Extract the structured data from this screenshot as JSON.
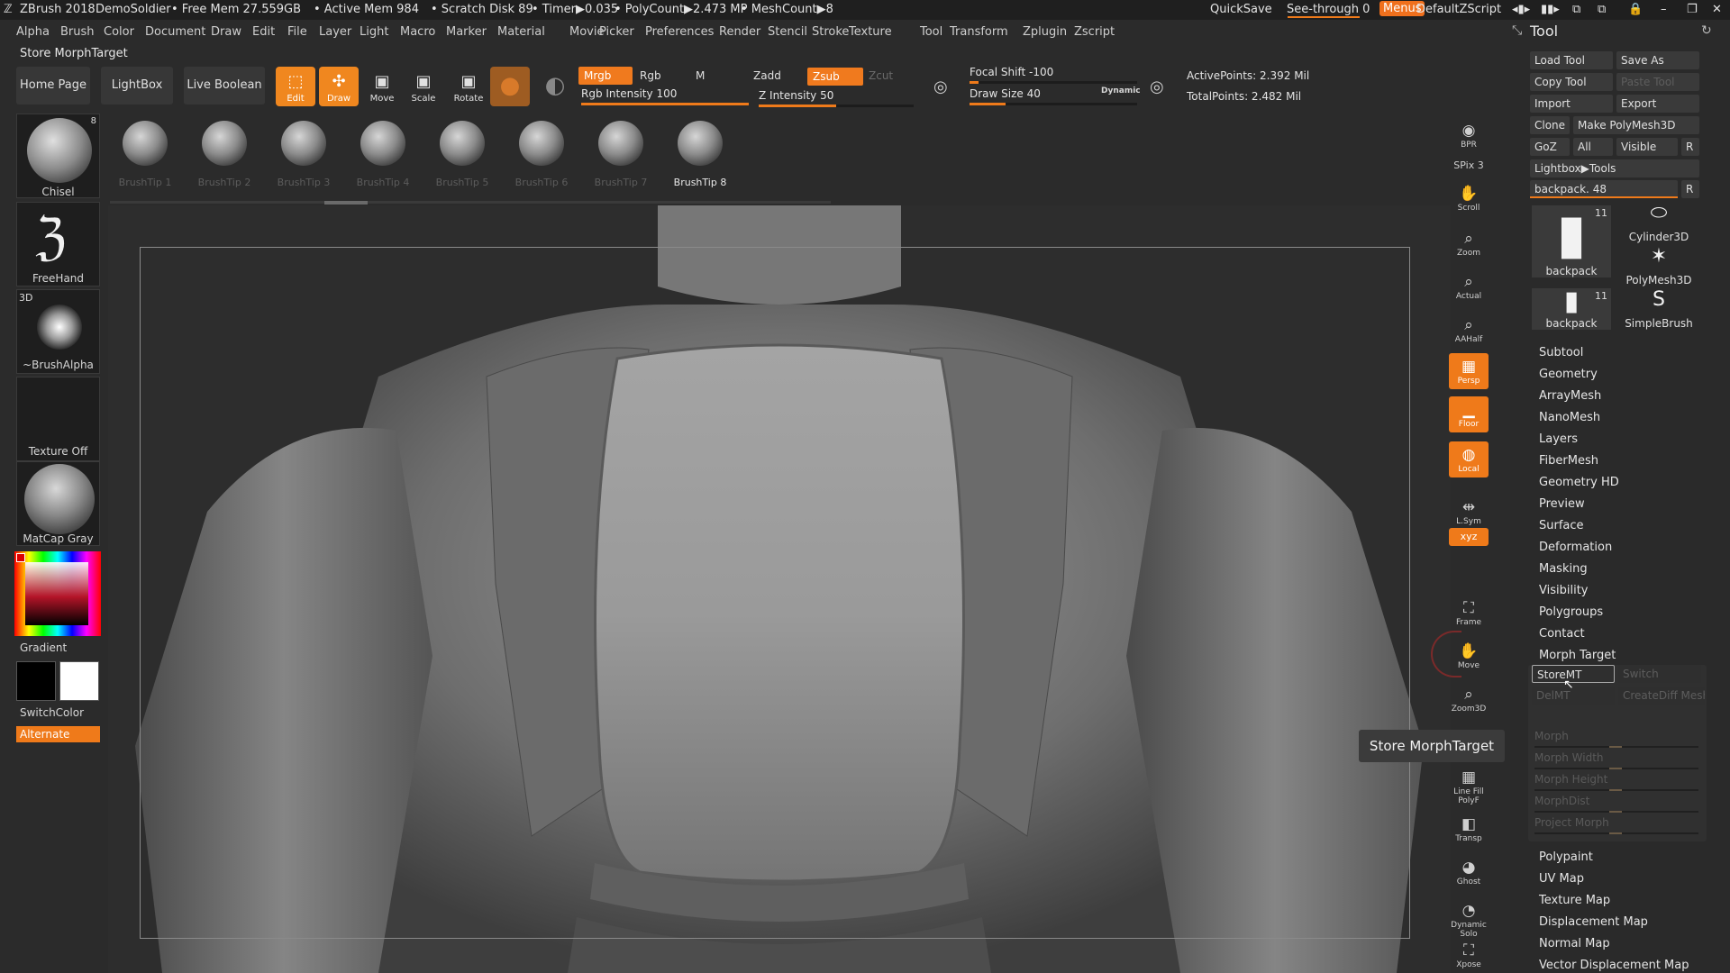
{
  "titlebar": {
    "app": "ZBrush 2018",
    "doc": "DemoSoldier",
    "free_mem": "• Free Mem 27.559GB",
    "active_mem": "• Active Mem 984",
    "scratch": "• Scratch Disk 89",
    "timer": "• Timer▶0.035",
    "polycount": "• PolyCount▶2.473 MP",
    "meshcount": "• MeshCount▶8",
    "quicksave": "QuickSave",
    "see_through": "See-through",
    "see_through_value": "0",
    "menus": "Menus",
    "script": "DefaultZScript"
  },
  "menubar": [
    "Alpha",
    "Brush",
    "Color",
    "Document",
    "Draw",
    "Edit",
    "File",
    "Layer",
    "Light",
    "Macro",
    "Marker",
    "Material",
    "Movie",
    "Picker",
    "Preferences",
    "Render",
    "Stencil",
    "Stroke",
    "Texture",
    "Tool",
    "Transform",
    "Zplugin",
    "Zscript"
  ],
  "status_text": "Store MorphTarget",
  "shelf": {
    "home": "Home Page",
    "lightbox": "LightBox",
    "live_boolean": "Live Boolean",
    "edit": "Edit",
    "draw": "Draw",
    "move": "Move",
    "scale": "Scale",
    "rotate": "Rotate",
    "mrgb": "Mrgb",
    "rgb": "Rgb",
    "m": "M",
    "zadd": "Zadd",
    "zsub": "Zsub",
    "zcut": "Zcut",
    "rgb_intensity_label": "Rgb Intensity",
    "rgb_intensity": "100",
    "rgb_intensity_level": 1.0,
    "z_intensity_label": "Z Intensity",
    "z_intensity": "50",
    "z_intensity_level": 0.5,
    "focal_shift_label": "Focal Shift",
    "focal_shift": "-100",
    "draw_size_label": "Draw Size",
    "draw_size": "40",
    "dynamic": "Dynamic",
    "active_points": "ActivePoints: 2.392 Mil",
    "total_points": "TotalPoints: 2.482 Mil"
  },
  "brushtips": [
    {
      "label": "BrushTip 1",
      "active": false
    },
    {
      "label": "BrushTip 2",
      "active": false
    },
    {
      "label": "BrushTip 3",
      "active": false
    },
    {
      "label": "BrushTip 4",
      "active": false
    },
    {
      "label": "BrushTip 5",
      "active": false
    },
    {
      "label": "BrushTip 6",
      "active": false
    },
    {
      "label": "BrushTip 7",
      "active": false
    },
    {
      "label": "BrushTip 8",
      "active": true
    }
  ],
  "left": {
    "brush": "Chisel",
    "brush_count": "8",
    "stroke": "FreeHand",
    "alpha_tag": "3D",
    "alpha": "~BrushAlpha",
    "texture": "Texture Off",
    "material": "MatCap Gray",
    "gradient": "Gradient",
    "switchcolor": "SwitchColor",
    "alternate": "Alternate"
  },
  "right_shelf": [
    {
      "label": "BPR",
      "glyph": "◉",
      "on": false
    },
    {
      "label": "SPix 3",
      "glyph": "",
      "on": false
    },
    {
      "label": "Scroll",
      "glyph": "✋",
      "on": false
    },
    {
      "label": "Zoom",
      "glyph": "⌕",
      "on": false
    },
    {
      "label": "Actual",
      "glyph": "⌕",
      "on": false
    },
    {
      "label": "AAHalf",
      "glyph": "⌕",
      "on": false
    },
    {
      "label": "Persp",
      "glyph": "▦",
      "on": true
    },
    {
      "label": "Floor",
      "glyph": "▁",
      "on": true
    },
    {
      "label": "Local",
      "glyph": "◍",
      "on": true
    },
    {
      "label": "L.Sym",
      "glyph": "⇹",
      "on": false
    },
    {
      "label": "xyz",
      "glyph": "",
      "on": true
    },
    {
      "label": "Frame",
      "glyph": "⛶",
      "on": false
    },
    {
      "label": "Move",
      "glyph": "✋",
      "on": false
    },
    {
      "label": "Zoom3D",
      "glyph": "⌕",
      "on": false
    },
    {
      "label": "Line Fill PolyF",
      "glyph": "▦",
      "on": false
    },
    {
      "label": "Transp",
      "glyph": "◧",
      "on": false
    },
    {
      "label": "Ghost",
      "glyph": "◕",
      "on": false
    },
    {
      "label": "Dynamic Solo",
      "glyph": "◔",
      "on": false
    },
    {
      "label": "Xpose",
      "glyph": "⛶",
      "on": false
    }
  ],
  "toolpanel": {
    "title": "Tool",
    "load_tool": "Load Tool",
    "save_as": "Save As",
    "copy_tool": "Copy Tool",
    "paste_tool": "Paste Tool",
    "import": "Import",
    "export": "Export",
    "clone": "Clone",
    "make_polymesh": "Make PolyMesh3D",
    "goz": "GoZ",
    "all": "All",
    "visible": "Visible",
    "r": "R",
    "lightbox_tools": "Lightbox▶Tools",
    "tool_name": "backpack.",
    "tool_value": "48",
    "thumbs": [
      {
        "label": "backpack",
        "count": "11"
      },
      {
        "label": "Cylinder3D",
        "count": ""
      },
      {
        "label": "PolyMesh3D",
        "count": ""
      },
      {
        "label": "backpack",
        "count": "11"
      },
      {
        "label": "SimpleBrush",
        "count": ""
      }
    ],
    "sections": [
      "Subtool",
      "Geometry",
      "ArrayMesh",
      "NanoMesh",
      "Layers",
      "FiberMesh",
      "Geometry HD",
      "Preview",
      "Surface",
      "Deformation",
      "Masking",
      "Visibility",
      "Polygroups",
      "Contact",
      "Morph Target"
    ],
    "morph": {
      "storemt": "StoreMT",
      "switch": "Switch",
      "delmt": "DelMT",
      "creatediff": "CreateDiff Mesh",
      "sliders": [
        "Morph",
        "Morph Width",
        "Morph Height",
        "MorphDist",
        "Project Morph"
      ]
    },
    "sections_after": [
      "Polypaint",
      "UV Map",
      "Texture Map",
      "Displacement Map",
      "Normal Map",
      "Vector Displacement Map"
    ]
  },
  "tooltip": "Store MorphTarget",
  "colors": {
    "accent": "#ef7a1a",
    "bg": "#2b2b2b"
  }
}
